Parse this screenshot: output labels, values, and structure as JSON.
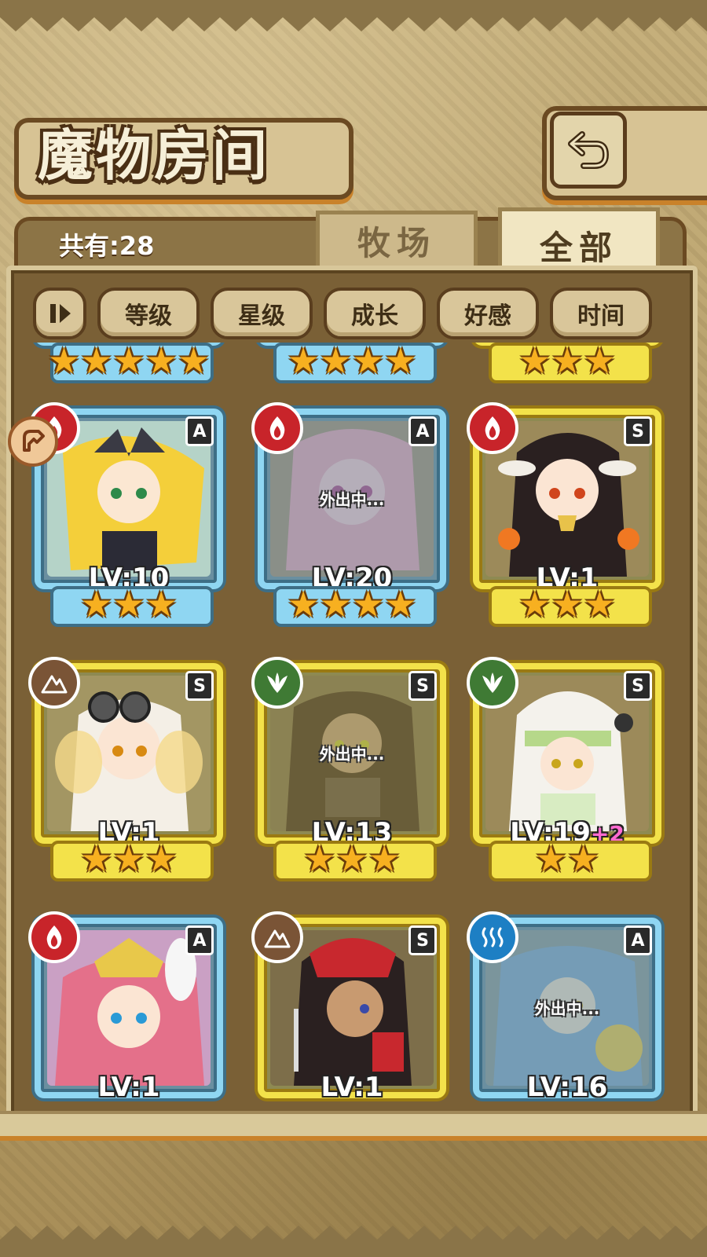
{
  "header": {
    "title": "魔物房间",
    "back_icon": "return-arrow-icon"
  },
  "summary": {
    "count_label": "共有:28"
  },
  "tabs": [
    {
      "label": "牧场",
      "selected": false
    },
    {
      "label": "全部",
      "selected": true
    }
  ],
  "sort": {
    "toggle_icon": "sort-toggle-icon",
    "buttons": [
      "等级",
      "星级",
      "成长",
      "好感",
      "时间"
    ]
  },
  "colors": {
    "fire": "#c8242a",
    "earth": "#7a5436",
    "grass": "#3f7a34",
    "water": "#1d7fc4",
    "frame_blue": "#8fd6f2",
    "frame_gold": "#f3e24a"
  },
  "partial_row": [
    {
      "frame": "blue",
      "stars": 5
    },
    {
      "frame": "blue",
      "stars": 4
    },
    {
      "frame": "gold",
      "stars": 3
    }
  ],
  "monsters": [
    {
      "element": "fire",
      "rank": "A",
      "frame": "blue",
      "level": "LV:10",
      "stars": 3,
      "out": false,
      "bonus": ""
    },
    {
      "element": "fire",
      "rank": "A",
      "frame": "blue",
      "level": "LV:20",
      "stars": 4,
      "out": true,
      "out_text": "外出中...",
      "bonus": ""
    },
    {
      "element": "fire",
      "rank": "S",
      "frame": "gold",
      "level": "LV:1",
      "stars": 3,
      "out": false,
      "bonus": ""
    },
    {
      "element": "earth",
      "rank": "S",
      "frame": "gold",
      "level": "LV:1",
      "stars": 3,
      "out": false,
      "bonus": ""
    },
    {
      "element": "grass",
      "rank": "S",
      "frame": "gold",
      "level": "LV:13",
      "stars": 3,
      "out": true,
      "out_text": "外出中...",
      "bonus": ""
    },
    {
      "element": "grass",
      "rank": "S",
      "frame": "gold",
      "level": "LV:19",
      "stars": 2,
      "out": false,
      "bonus": "+2"
    },
    {
      "element": "fire",
      "rank": "A",
      "frame": "blue",
      "level": "LV:1",
      "stars": 0,
      "out": false,
      "bonus": ""
    },
    {
      "element": "earth",
      "rank": "S",
      "frame": "gold",
      "level": "LV:1",
      "stars": 0,
      "out": false,
      "bonus": ""
    },
    {
      "element": "water",
      "rank": "A",
      "frame": "blue",
      "level": "LV:16",
      "stars": 0,
      "out": true,
      "out_text": "外出中...",
      "bonus": ""
    }
  ]
}
